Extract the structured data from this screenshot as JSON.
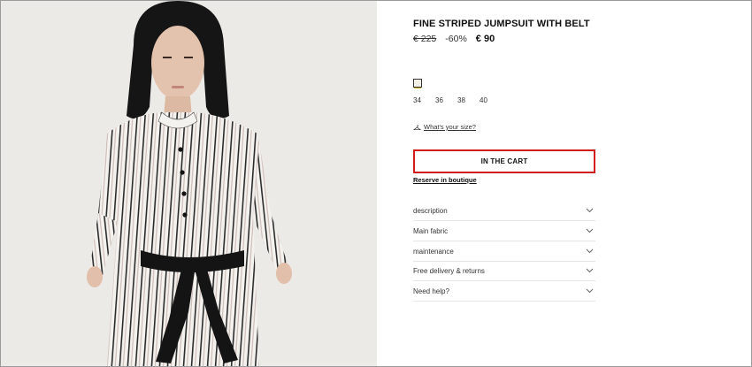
{
  "product": {
    "title": "FINE STRIPED JUMPSUIT WITH BELT",
    "old_price": "€ 225",
    "discount": "-60%",
    "new_price": "€ 90",
    "sizes": [
      "34",
      "36",
      "38",
      "40"
    ],
    "size_guide_label": "What's your size?",
    "add_to_cart_label": "IN THE CART",
    "reserve_label": "Reserve in boutique"
  },
  "accordion": [
    {
      "label": "description"
    },
    {
      "label": "Main fabric"
    },
    {
      "label": "maintenance"
    },
    {
      "label": "Free delivery & returns"
    },
    {
      "label": "Need help?"
    }
  ],
  "colors": {
    "highlight_border": "#d01c1c",
    "swatch": "#f3f1e6"
  }
}
